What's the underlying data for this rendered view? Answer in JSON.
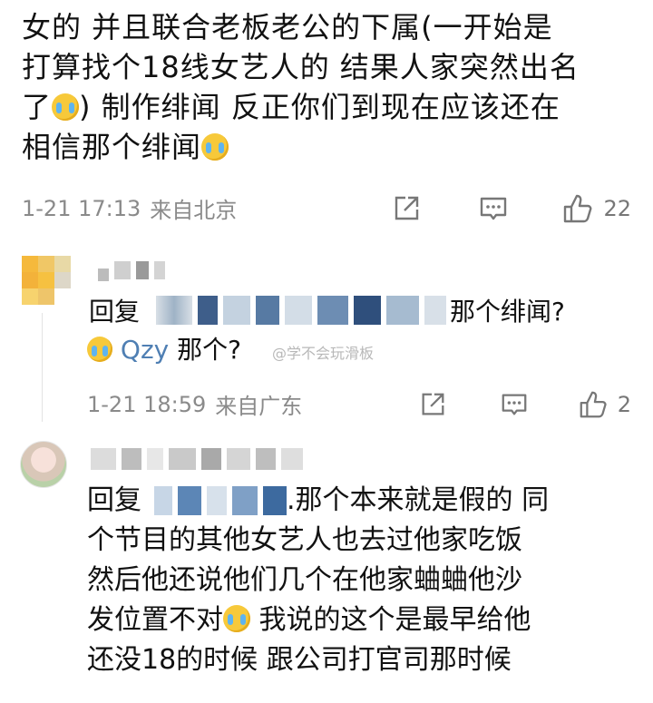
{
  "post": {
    "text_line1": "女的  并且联合老板老公的下属(一开始是",
    "text_line2": "打算找个18线女艺人的  结果人家突然出名",
    "text_line3a": "了",
    "text_line3b": ") 制作绯闻  反正你们到现在应该还在",
    "text_line4": "相信那个绯闻",
    "time": "1-21 17:13",
    "source": "来自北京",
    "like_count": "22"
  },
  "reply1": {
    "prefix": "回复",
    "suffix": "那个绯闻?",
    "user": "Qzy",
    "text": "那个?",
    "time": "1-21 18:59",
    "source": "来自广东",
    "like_count": "2"
  },
  "watermark": "@学不会玩滑板",
  "reply2": {
    "prefix": "回复",
    "line1_tail": ".那个本来就是假的  同",
    "line2": "个节目的其他女艺人也去过他家吃饭",
    "line3": "然后他还说他们几个在他家蛐蛐他沙",
    "line4a": "发位置不对",
    "line4b": "  我说的这个是最早给他",
    "line5": "还没18的时候  跟公司打官司那时候"
  },
  "icons": {
    "share": "share-icon",
    "comment": "comment-icon",
    "like": "thumbs-up-icon"
  }
}
